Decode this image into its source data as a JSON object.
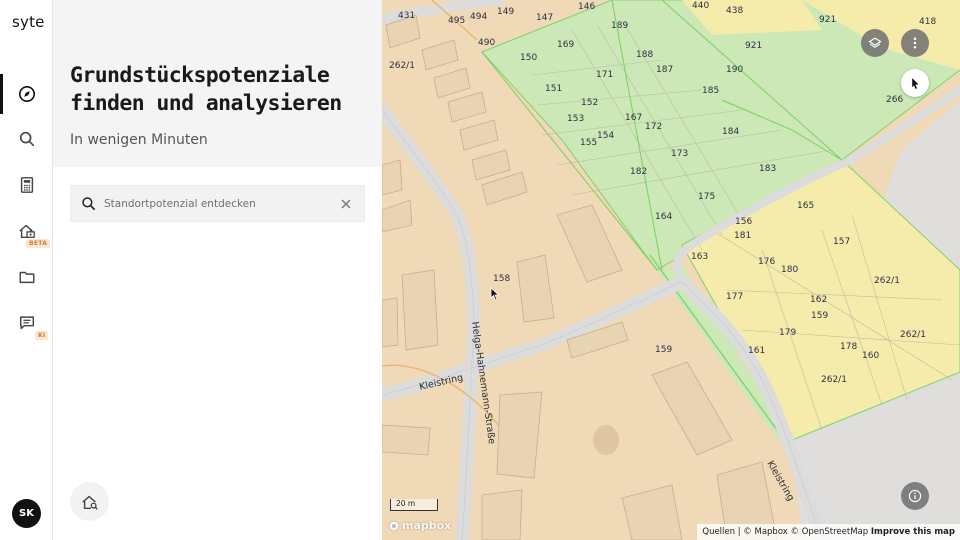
{
  "app": {
    "logo": "syte"
  },
  "rail": {
    "items": [
      {
        "name": "explore",
        "icon": "compass-icon",
        "active": true
      },
      {
        "name": "search",
        "icon": "search-icon"
      },
      {
        "name": "calculator",
        "icon": "calculator-icon"
      },
      {
        "name": "building",
        "icon": "house-building-icon",
        "badge": "BETA"
      },
      {
        "name": "folder",
        "icon": "folder-icon"
      },
      {
        "name": "chat",
        "icon": "chat-icon",
        "badge": "KI"
      }
    ],
    "avatar_initials": "SK"
  },
  "panel": {
    "title": "Grundstückspotenziale finden und analysieren",
    "subtitle": "In wenigen Minuten",
    "search": {
      "placeholder": "Standortpotenzial entdecken",
      "value": ""
    }
  },
  "map": {
    "plot_labels": [
      "431",
      "495",
      "494",
      "149",
      "147",
      "146",
      "189",
      "440",
      "438",
      "921",
      "418",
      "490",
      "169",
      "188",
      "187",
      "921",
      "190",
      "262/1",
      "150",
      "171",
      "185",
      "266",
      "151",
      "152",
      "167",
      "172",
      "184",
      "153",
      "154",
      "173",
      "183",
      "155",
      "182",
      "165",
      "175",
      "156",
      "164",
      "181",
      "157",
      "163",
      "176",
      "180",
      "262/1",
      "158",
      "177",
      "162",
      "159",
      "179",
      "262/1",
      "159",
      "161",
      "178",
      "160",
      "262/1"
    ],
    "street_labels": [
      "Helga-Hahnemann-Straße",
      "Kleistring",
      "Kleistring"
    ],
    "scale_label": "20 m",
    "attribution": {
      "sources": "Quellen | © Mapbox © OpenStreetMap",
      "improve": "Improve this map"
    },
    "logo_text": "mapbox",
    "colors": {
      "residential": "#efd9b6",
      "green": "#c9e8b4",
      "yellow": "#f5ecab",
      "gray": "#e0dedc",
      "road": "#dcdcdc"
    }
  }
}
